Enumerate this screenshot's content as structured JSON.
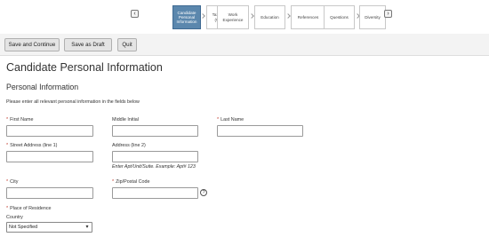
{
  "wizard": {
    "steps": [
      {
        "label": "Candidate\nPersonal\nInformation",
        "active": true
      },
      {
        "label": "Tax Survey\n(WOTC)",
        "active": false
      },
      {
        "label": "Work\nExperience",
        "active": false
      },
      {
        "label": "Education",
        "active": false
      },
      {
        "label": "References",
        "active": false
      },
      {
        "label": "Questions",
        "active": false
      },
      {
        "label": "Diversity",
        "active": false
      }
    ],
    "prev_icon": "step-back-icon",
    "next_icon": "step-forward-icon",
    "active_color": "#5b87ad"
  },
  "toolbar": {
    "save_continue_label": "Save and Continue",
    "save_draft_label": "Save as Draft",
    "quit_label": "Quit"
  },
  "page": {
    "title": "Candidate Personal Information",
    "section_title": "Personal Information",
    "instructions": "Please enter all relevant personal information in the fields below"
  },
  "form": {
    "required_marker": "*",
    "first_name": {
      "label": "First Name",
      "value": ""
    },
    "middle_initial": {
      "label": "Middle Initial",
      "value": ""
    },
    "last_name": {
      "label": "Last Name",
      "value": ""
    },
    "street_1": {
      "label": "Street Address (line 1)",
      "value": ""
    },
    "street_2": {
      "label": "Address (line 2)",
      "value": "",
      "hint": "Enter Apt/Unit/Suite. Example: Apt# 123"
    },
    "city": {
      "label": "City",
      "value": ""
    },
    "zip": {
      "label": "Zip/Postal Code",
      "value": "",
      "help_glyph": "?"
    },
    "residence": {
      "label": "Place of Residence",
      "country_label": "Country",
      "country_value": "Not Specified"
    }
  },
  "colors": {
    "required": "#c0392b"
  }
}
